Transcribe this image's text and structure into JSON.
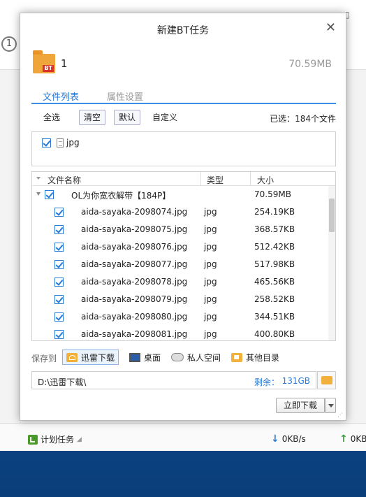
{
  "background_app": {
    "status": {
      "plan_task_label": "计划任务",
      "download_speed": "0KB/s",
      "upload_speed": "0KB"
    }
  },
  "dialog": {
    "title": "新建BT任务",
    "close_glyph": "✕",
    "task": {
      "name": "1",
      "size": "70.59MB",
      "badge": "BT"
    },
    "tabs": [
      {
        "label": "文件列表",
        "active": true
      },
      {
        "label": "属性设置",
        "active": false
      }
    ],
    "toolbar": {
      "select_all": "全选",
      "clear": "清空",
      "default": "默认",
      "custom": "自定义",
      "selected_count": "已选：184个文件"
    },
    "filter": {
      "ext_label": "jpg"
    },
    "table": {
      "columns": [
        "文件名称",
        "类型",
        "大小"
      ],
      "folder": {
        "name": "OL为你宽衣解带【184P】",
        "size": "70.59MB"
      },
      "rows": [
        {
          "name": "aida-sayaka-2098074.jpg",
          "type": "jpg",
          "size": "254.19KB"
        },
        {
          "name": "aida-sayaka-2098075.jpg",
          "type": "jpg",
          "size": "368.57KB"
        },
        {
          "name": "aida-sayaka-2098076.jpg",
          "type": "jpg",
          "size": "512.42KB"
        },
        {
          "name": "aida-sayaka-2098077.jpg",
          "type": "jpg",
          "size": "517.98KB"
        },
        {
          "name": "aida-sayaka-2098078.jpg",
          "type": "jpg",
          "size": "465.56KB"
        },
        {
          "name": "aida-sayaka-2098079.jpg",
          "type": "jpg",
          "size": "258.52KB"
        },
        {
          "name": "aida-sayaka-2098080.jpg",
          "type": "jpg",
          "size": "344.51KB"
        },
        {
          "name": "aida-sayaka-2098081.jpg",
          "type": "jpg",
          "size": "400.80KB"
        }
      ]
    },
    "save": {
      "label": "保存到",
      "options": [
        {
          "label": "迅雷下载",
          "icon": "thunder-folder-icon",
          "active": true
        },
        {
          "label": "桌面",
          "icon": "desktop-icon",
          "active": false
        },
        {
          "label": "私人空间",
          "icon": "cloud-icon",
          "active": false
        },
        {
          "label": "其他目录",
          "icon": "folder-icon",
          "active": false
        }
      ],
      "path": "D:\\迅雷下载\\",
      "free_label": "剩余：",
      "free_value": "131GB"
    },
    "download_button": "立即下载"
  }
}
